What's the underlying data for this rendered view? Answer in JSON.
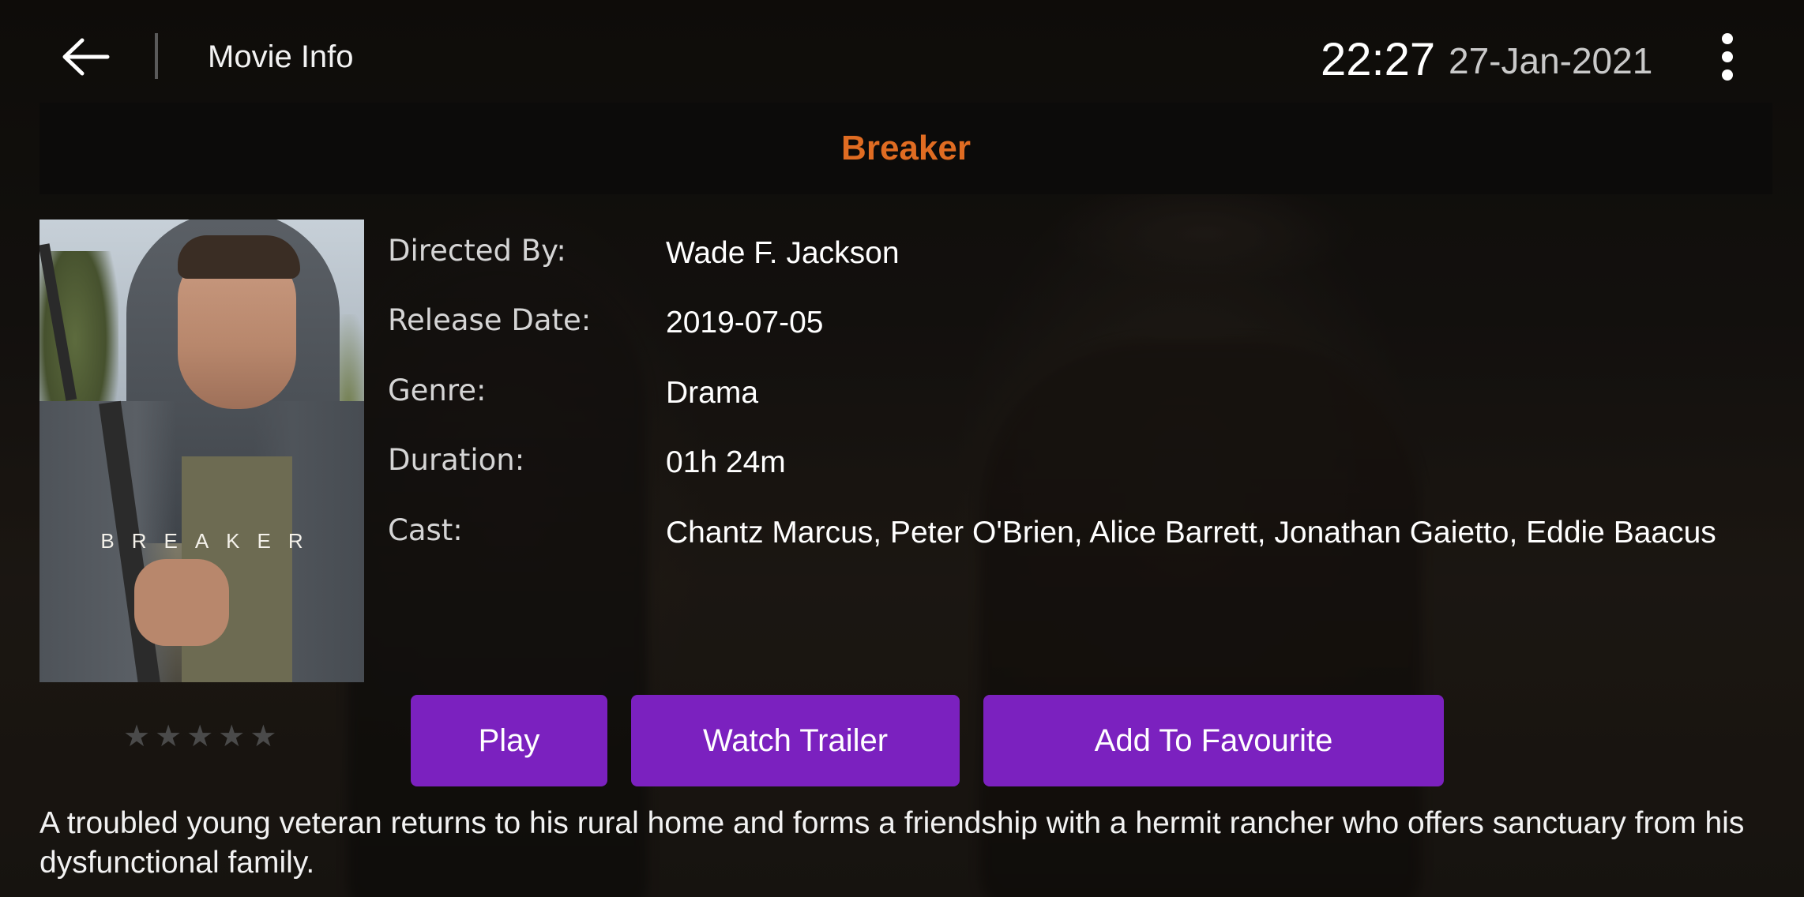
{
  "header": {
    "page_title": "Movie Info",
    "time": "22:27",
    "date": "27-Jan-2021",
    "back_icon": "arrow-left-icon",
    "menu_icon": "more-vert-icon"
  },
  "movie": {
    "title": "Breaker",
    "poster_text": "BREAKER",
    "rating": {
      "value": 0,
      "max": 5
    },
    "details": [
      {
        "label": "Directed By:",
        "value": "Wade F. Jackson"
      },
      {
        "label": "Release Date:",
        "value": "2019-07-05"
      },
      {
        "label": "Genre:",
        "value": "Drama"
      },
      {
        "label": "Duration:",
        "value": "01h 24m"
      },
      {
        "label": "Cast:",
        "value": "Chantz Marcus, Peter O'Brien, Alice Barrett, Jonathan Gaietto, Eddie Baacus"
      }
    ],
    "description": "A troubled young veteran returns to his rural home and forms a friendship with a hermit rancher who offers sanctuary from his dysfunctional family."
  },
  "actions": {
    "play_label": "Play",
    "trailer_label": "Watch Trailer",
    "favourite_label": "Add To Favourite"
  },
  "colors": {
    "accent_title": "#e06c22",
    "button_bg": "#7b21bf",
    "title_bar_bg": "#0c0b0a"
  }
}
